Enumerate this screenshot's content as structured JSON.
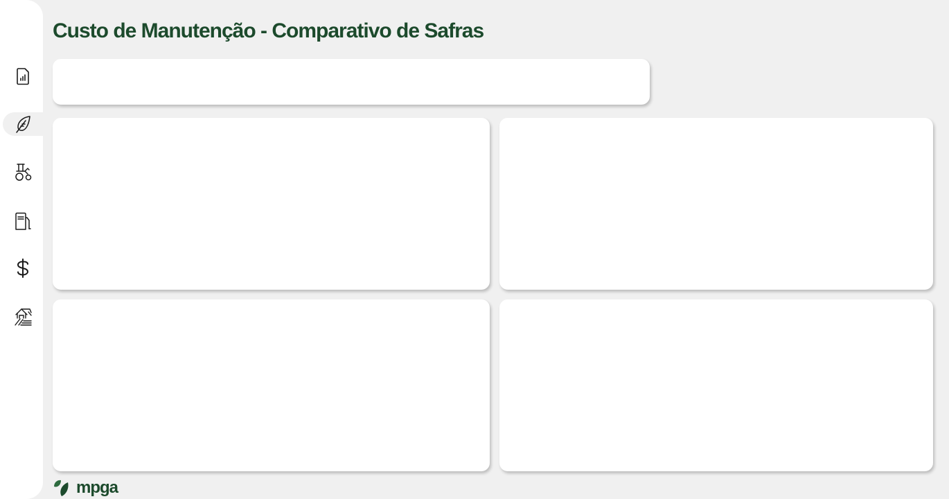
{
  "page": {
    "title": "Custo de Manutenção - Comparativo de Safras"
  },
  "sidebar": {
    "items": [
      {
        "icon": "report-chart-icon",
        "active": false
      },
      {
        "icon": "leaf-icon",
        "active": true
      },
      {
        "icon": "tractor-icon",
        "active": false
      },
      {
        "icon": "fuel-pump-icon",
        "active": false
      },
      {
        "icon": "dollar-icon",
        "active": false
      },
      {
        "icon": "farm-field-icon",
        "active": false
      }
    ]
  },
  "brand": {
    "name": "mpga",
    "colors": {
      "primary": "#1c4a2c",
      "leaf": "#2e6b3f"
    }
  }
}
